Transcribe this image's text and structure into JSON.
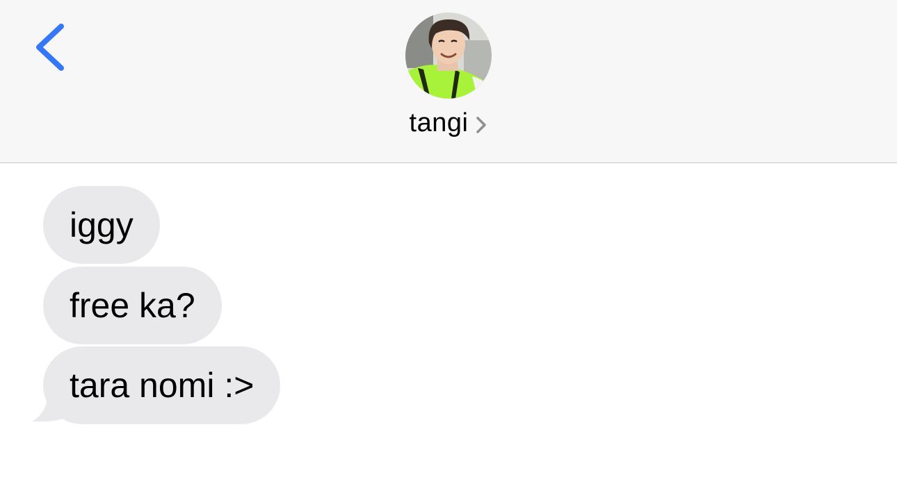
{
  "colors": {
    "header_background": "#f7f7f8",
    "accent": "#3478f6",
    "received_bubble": "#e9e9eb",
    "chevron": "#8e8e93"
  },
  "header": {
    "back_icon": "chevron-left-icon",
    "contact_name": "tangi",
    "contact_chevron_icon": "chevron-right-icon"
  },
  "messages": [
    {
      "direction": "received",
      "text": "iggy"
    },
    {
      "direction": "received",
      "text": "free ka?"
    },
    {
      "direction": "received",
      "text": "tara nomi :>"
    }
  ]
}
